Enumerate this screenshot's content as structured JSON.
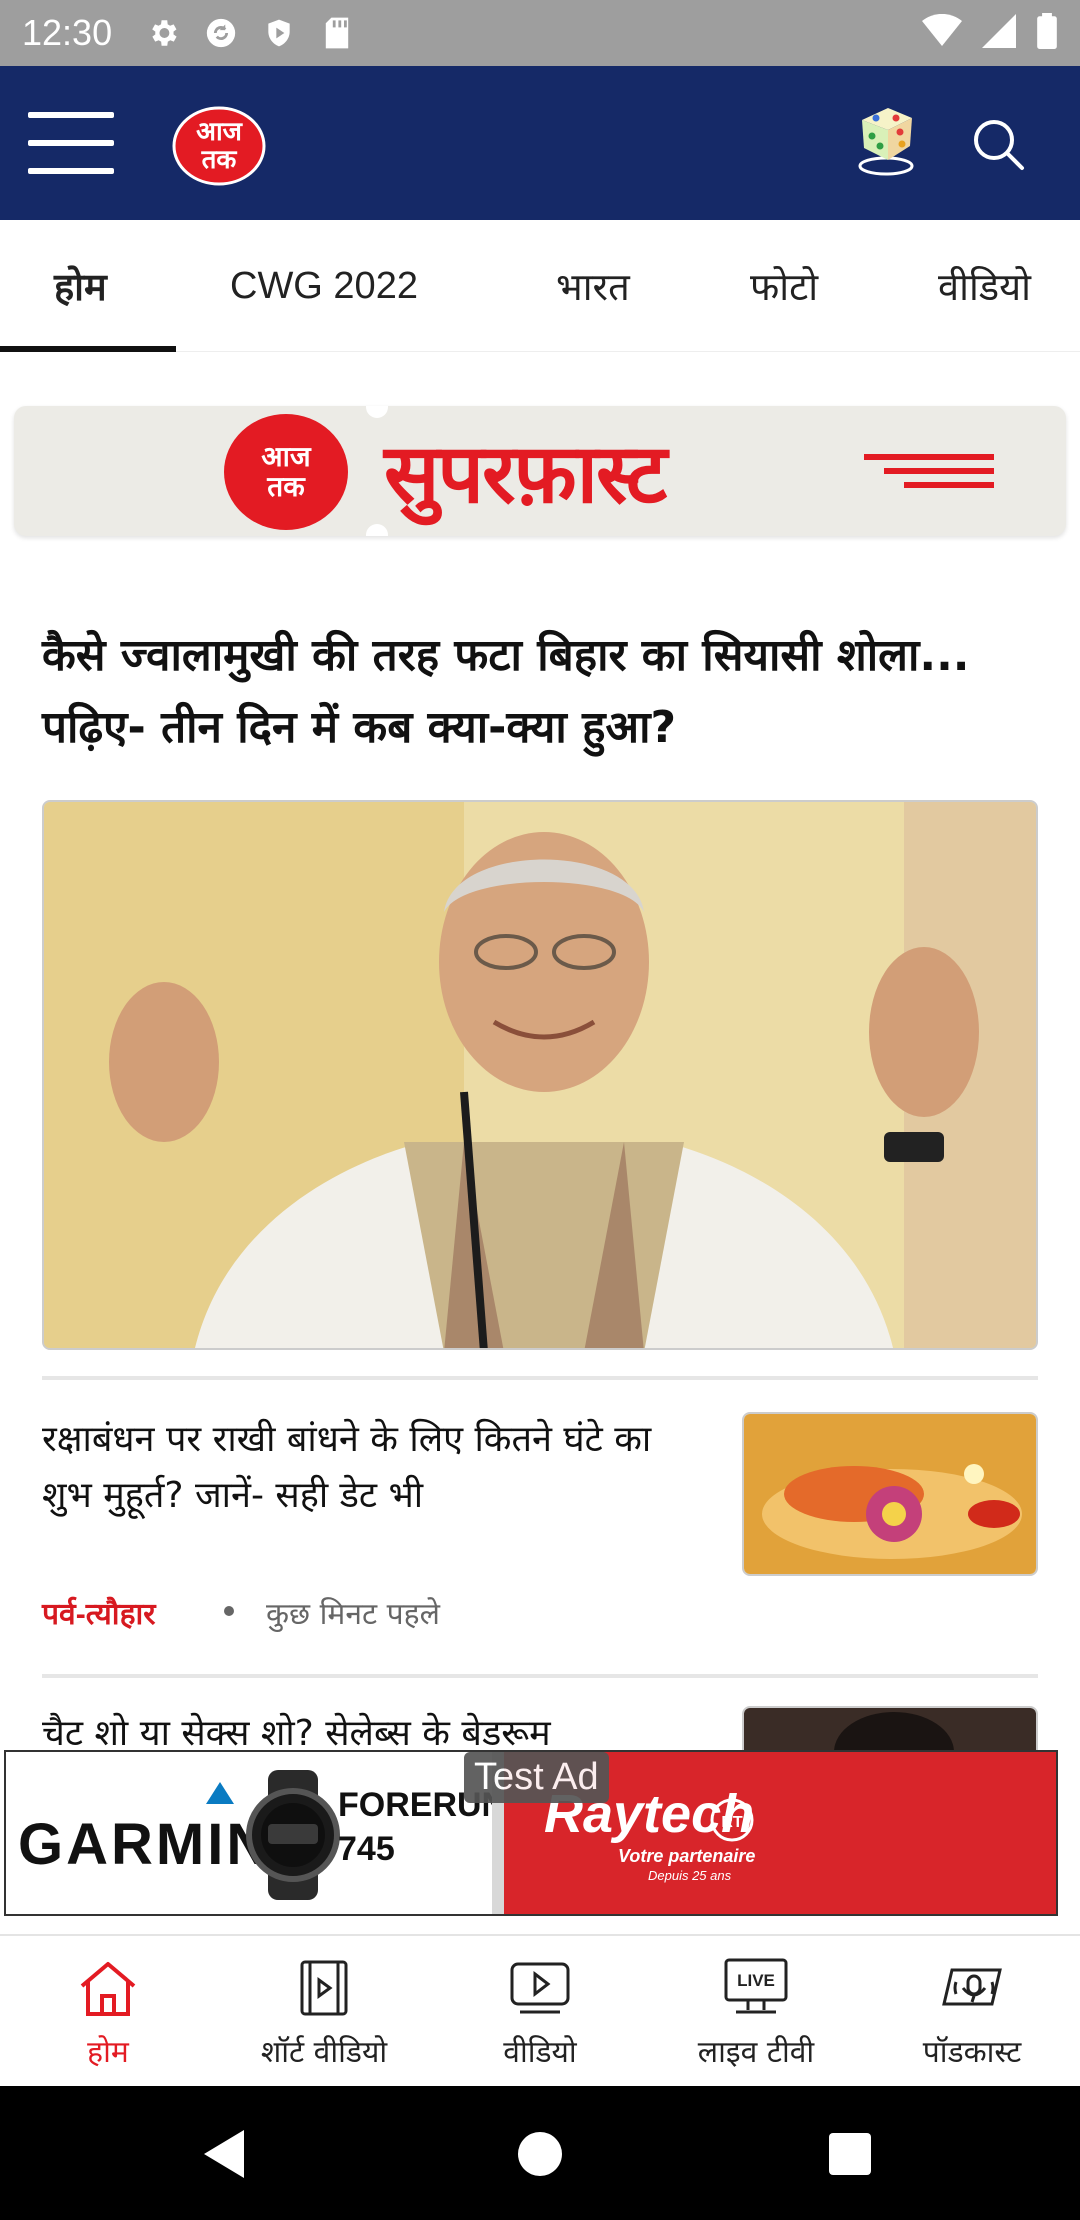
{
  "status_bar": {
    "time": "12:30",
    "left_icons": [
      "settings-icon",
      "sync-icon",
      "shield-icon",
      "sd-card-icon"
    ],
    "right_icons": [
      "wifi-icon",
      "signal-icon",
      "battery-icon"
    ]
  },
  "header": {
    "logo_text_top": "आज",
    "logo_text_bottom": "तक",
    "brand_color": "#152967",
    "accent_color": "#e31b23"
  },
  "tabs": [
    {
      "label": "होम",
      "active": true
    },
    {
      "label": "CWG 2022",
      "active": false
    },
    {
      "label": "भारत",
      "active": false
    },
    {
      "label": "फोटो",
      "active": false
    },
    {
      "label": "वीडियो",
      "active": false
    }
  ],
  "superfast": {
    "logo_top": "आज",
    "logo_bottom": "तक",
    "title": "सुपरफ़ास्ट"
  },
  "main_story": {
    "headline": "कैसे ज्वालामुखी की तरह फटा बिहार का सियासी शोला... पढ़िए- तीन दिन में कब क्या-क्या हुआ?"
  },
  "news_items": [
    {
      "title": "रक्षाबंधन पर राखी बांधने के लिए कितने घंटे का शुभ मुहूर्त? जानें- सही डेट भी",
      "category": "पर्व-त्यौहार",
      "time": "कुछ मिनट पहले"
    },
    {
      "title": "चैट शो या सेक्स शो? सेलेब्स के बेडरूम"
    }
  ],
  "ad": {
    "badge": "Test Ad",
    "brand": "GARMIN",
    "product_line1": "FORERUNNER",
    "product_line2": "745",
    "partner": "Raytech",
    "partner_tagline": "Votre partenaire",
    "partner_since": "Depuis 25 ans",
    "partner_mark": "RT"
  },
  "bottom_nav": [
    {
      "label": "होम",
      "icon": "home-icon",
      "active": true
    },
    {
      "label": "शॉर्ट वीडियो",
      "icon": "short-video-icon",
      "active": false
    },
    {
      "label": "वीडियो",
      "icon": "video-icon",
      "active": false
    },
    {
      "label": "लाइव टीवी",
      "icon": "live-tv-icon",
      "active": false,
      "badge": "LIVE"
    },
    {
      "label": "पॉडकास्ट",
      "icon": "podcast-icon",
      "active": false
    }
  ]
}
